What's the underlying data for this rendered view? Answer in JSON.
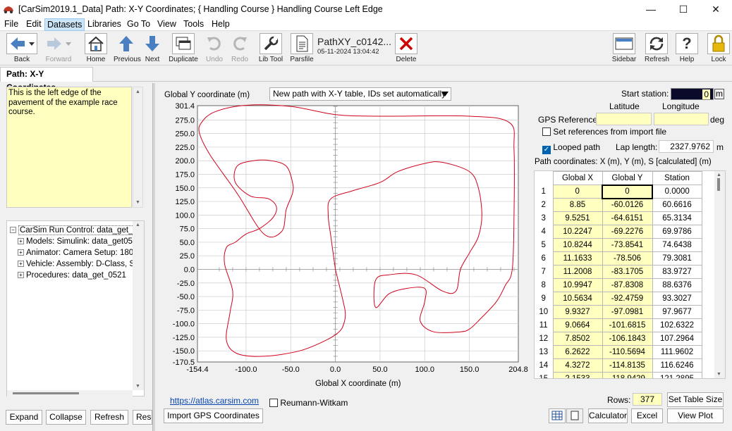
{
  "window": {
    "title": "[CarSim2019.1_Data] Path: X-Y Coordinates; { Handling Course } Handling Course Left Edge",
    "minimize": "—",
    "maximize": "☐",
    "close": "✕"
  },
  "menu": [
    "File",
    "Edit",
    "Datasets",
    "Libraries",
    "Go To",
    "View",
    "Tools",
    "Help"
  ],
  "toolbar": {
    "back": "Back",
    "forward": "Forward",
    "home": "Home",
    "previous": "Previous",
    "next": "Next",
    "duplicate": "Duplicate",
    "undo": "Undo",
    "redo": "Redo",
    "lib_tool": "Lib Tool",
    "parsfile": "Parsfile",
    "parsfile_name": "PathXY_c0142...",
    "parsfile_date": "05-11-2024 13:04:42",
    "delete": "Delete",
    "sidebar": "Sidebar",
    "refresh": "Refresh",
    "help": "Help",
    "lock": "Lock"
  },
  "tab": "Path: X-Y Coordinates",
  "notes": "This is the left edge of the pavement of the example race course.",
  "tree": {
    "root": "CarSim Run Control: data_get_",
    "children": [
      "Models: Simulink: data_get05",
      "Animator: Camera Setup: 180",
      "Vehicle: Assembly: D-Class, S",
      "Procedures: data_get_0521"
    ]
  },
  "left_buttons": {
    "expand": "Expand",
    "collapse": "Collapse",
    "refresh": "Refresh",
    "reset": "Rese"
  },
  "path_mode": "New path with X-Y table, IDs set automatically",
  "link": "https://atlas.carsim.com",
  "reumann": "Reumann-Witkam",
  "import_gps": "Import GPS Coordinates",
  "start_station": {
    "label": "Start station:",
    "value": "0",
    "unit": "m"
  },
  "gps": {
    "label": "GPS References",
    "latitude": "Latitude",
    "longitude": "Longitude",
    "unit": "deg",
    "set_refs": "Set references from import file"
  },
  "looped": {
    "label": "Looped path",
    "checked": true
  },
  "lap": {
    "label": "Lap length:",
    "value": "2327.9762",
    "unit": "m"
  },
  "table": {
    "caption": "Path coordinates: X (m), Y (m), S [calculated] (m)",
    "headers": [
      "Global X",
      "Global Y",
      "Station"
    ],
    "rows": [
      [
        "1",
        "0",
        "0",
        "0.0000"
      ],
      [
        "2",
        "8.85",
        "-60.0126",
        "60.6616"
      ],
      [
        "3",
        "9.5251",
        "-64.6151",
        "65.3134"
      ],
      [
        "4",
        "10.2247",
        "-69.2276",
        "69.9786"
      ],
      [
        "5",
        "10.8244",
        "-73.8541",
        "74.6438"
      ],
      [
        "6",
        "11.1633",
        "-78.506",
        "79.3081"
      ],
      [
        "7",
        "11.2008",
        "-83.1705",
        "83.9727"
      ],
      [
        "8",
        "10.9947",
        "-87.8308",
        "88.6376"
      ],
      [
        "9",
        "10.5634",
        "-92.4759",
        "93.3027"
      ],
      [
        "10",
        "9.9327",
        "-97.0981",
        "97.9677"
      ],
      [
        "11",
        "9.0664",
        "-101.6815",
        "102.6322"
      ],
      [
        "12",
        "7.8502",
        "-106.1843",
        "107.2964"
      ],
      [
        "13",
        "6.2622",
        "-110.5694",
        "111.9602"
      ],
      [
        "14",
        "4.3272",
        "-114.8135",
        "116.6246"
      ],
      [
        "15",
        "2.1533",
        "-118.9429",
        "121.2895"
      ]
    ]
  },
  "rows_label": "Rows:",
  "rows_value": "377",
  "set_table_size": "Set Table Size",
  "calculator": "Calculator",
  "excel": "Excel",
  "view_plot": "View Plot",
  "chart_data": {
    "type": "line",
    "ylabel": "Global Y coordinate (m)",
    "xlabel": "Global X coordinate (m)",
    "xlim": [
      -154.4,
      204.8
    ],
    "ylim": [
      -170.5,
      301.4
    ],
    "xticks": [
      "-154.4",
      "-100.0",
      "-50.0",
      "0.0",
      "50.0",
      "100.0",
      "150.0",
      "204.8"
    ],
    "yticks": [
      "301.4",
      "275.0",
      "250.0",
      "225.0",
      "200.0",
      "175.0",
      "150.0",
      "125.0",
      "100.0",
      "75.0",
      "50.0",
      "25.0",
      "0.0",
      "-25.0",
      "-50.0",
      "-75.0",
      "-100.0",
      "-125.0",
      "-150.0",
      "-170.5"
    ],
    "line_color": "#d0021b",
    "series": [
      {
        "x": [
          0,
          8.85,
          11.2,
          9.07,
          4.3,
          -10,
          -40,
          -80,
          -110,
          -122,
          -118,
          -115,
          -124,
          -122,
          -112,
          -100,
          -85,
          -70,
          -66,
          -75,
          -95,
          -112,
          -110,
          -92,
          -72,
          -55,
          -48,
          -48,
          -55,
          -60,
          -80,
          -110,
          -140,
          -152,
          -150,
          -135,
          -100,
          -50,
          0,
          50,
          150,
          195,
          200,
          200,
          198,
          190,
          180,
          160,
          150,
          140,
          110,
          95,
          100,
          100,
          80,
          60,
          45,
          45,
          60,
          90,
          120,
          135,
          140,
          150,
          160,
          164,
          160,
          150,
          120,
          100,
          70,
          50,
          20,
          -5,
          -8,
          -5,
          0
        ],
        "y": [
          0,
          -60.0,
          -83.2,
          -101.7,
          -114.8,
          -130,
          -150,
          -160,
          -155,
          -130,
          -80,
          -40,
          10,
          40,
          50,
          65,
          75,
          95,
          115,
          130,
          135,
          160,
          190,
          200,
          200,
          190,
          160,
          140,
          110,
          70,
          65,
          140,
          210,
          250,
          270,
          290,
          302,
          300,
          285,
          282,
          282,
          270,
          220,
          100,
          0,
          -30,
          -60,
          -95,
          -110,
          -115,
          -115,
          -95,
          -60,
          -35,
          -35,
          -45,
          -70,
          -20,
          -10,
          -10,
          -40,
          -40,
          0,
          30,
          60,
          100,
          150,
          180,
          197,
          195,
          180,
          160,
          145,
          130,
          100,
          60,
          0
        ]
      }
    ]
  }
}
